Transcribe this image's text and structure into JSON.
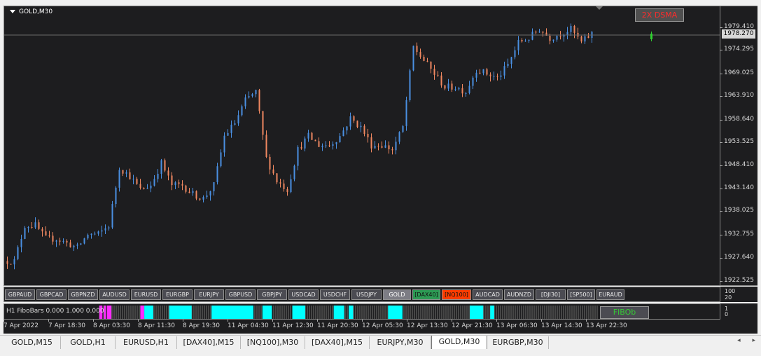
{
  "chart": {
    "symbol_title": "GOLD,M30",
    "indicator_label": "2X DSMA",
    "current_price": "1978.270",
    "price_ticks": [
      "1979.410",
      "1974.295",
      "1969.025",
      "1963.910",
      "1958.640",
      "1953.525",
      "1948.410",
      "1943.140",
      "1938.025",
      "1932.755",
      "1927.640",
      "1922.525"
    ],
    "time_labels": [
      "7 Apr 2022",
      "7 Apr 18:30",
      "8 Apr 03:30",
      "8 Apr 11:30",
      "8 Apr 19:30",
      "11 Apr 04:30",
      "11 Apr 12:30",
      "11 Apr 20:30",
      "12 Apr 05:30",
      "12 Apr 13:30",
      "12 Apr 21:30",
      "13 Apr 06:30",
      "13 Apr 14:30",
      "13 Apr 22:30"
    ],
    "bull_color": "#4a90e2",
    "bear_color": "#f08860"
  },
  "chart_data": {
    "type": "candlestick",
    "ylim": [
      1922.525,
      1979.41
    ],
    "anchors": [
      1927,
      1927,
      1935,
      1935,
      1932,
      1932,
      1931,
      1930,
      1933,
      1933,
      1935,
      1948,
      1946,
      1943,
      1944,
      1949,
      1944,
      1944,
      1942,
      1941,
      1944,
      1955,
      1958,
      1963,
      1965,
      1950,
      1945,
      1943,
      1952,
      1955,
      1953,
      1953,
      1955,
      1959,
      1957,
      1953,
      1953,
      1952,
      1957,
      1975,
      1972,
      1969,
      1966,
      1966,
      1965,
      1970,
      1969,
      1968,
      1971,
      1976,
      1977,
      1979,
      1977,
      1978,
      1979,
      1976,
      1978
    ],
    "candle_count": 168
  },
  "symbol_buttons": [
    {
      "label": "GBPAUD",
      "state": "normal"
    },
    {
      "label": "GBPCAD",
      "state": "normal"
    },
    {
      "label": "GBPNZD",
      "state": "normal"
    },
    {
      "label": "AUDUSD",
      "state": "normal"
    },
    {
      "label": "EURUSD",
      "state": "normal"
    },
    {
      "label": "EURGBP",
      "state": "normal"
    },
    {
      "label": "EURJPY",
      "state": "normal"
    },
    {
      "label": "GBPUSD",
      "state": "normal"
    },
    {
      "label": "GBPJPY",
      "state": "normal"
    },
    {
      "label": "USDCAD",
      "state": "normal"
    },
    {
      "label": "USDCHF",
      "state": "normal"
    },
    {
      "label": "USDJPY",
      "state": "normal"
    },
    {
      "label": "GOLD",
      "state": "selected"
    },
    {
      "label": "[DAX40]",
      "state": "green"
    },
    {
      "label": "[NQ100]",
      "state": "red"
    },
    {
      "label": "AUDCAD",
      "state": "normal"
    },
    {
      "label": "AUDNZD",
      "state": "normal"
    },
    {
      "label": "[DJI30]",
      "state": "normal"
    },
    {
      "label": "[SP500]",
      "state": "normal"
    },
    {
      "label": "EURAUD",
      "state": "normal"
    }
  ],
  "button_axis": {
    "top": "100",
    "bottom": "20"
  },
  "fibo": {
    "label": "H1 FiboBars 0.000 1.000 0.000",
    "button": "FIBOb",
    "axis_top": "1",
    "axis_bottom": "0",
    "segments": [
      {
        "from": 0.0,
        "to": 0.006,
        "color": "#ff2bff"
      },
      {
        "from": 0.009,
        "to": 0.013,
        "color": "#ff2bff"
      },
      {
        "from": 0.015,
        "to": 0.024,
        "color": "#ff2bff"
      },
      {
        "from": 0.082,
        "to": 0.09,
        "color": "#ff2bff"
      },
      {
        "from": 0.09,
        "to": 0.108,
        "color": "#00ffff"
      },
      {
        "from": 0.14,
        "to": 0.185,
        "color": "#00ffff"
      },
      {
        "from": 0.225,
        "to": 0.309,
        "color": "#00ffff"
      },
      {
        "from": 0.327,
        "to": 0.346,
        "color": "#00ffff"
      },
      {
        "from": 0.387,
        "to": 0.413,
        "color": "#00ffff"
      },
      {
        "from": 0.47,
        "to": 0.491,
        "color": "#00ffff"
      },
      {
        "from": 0.5,
        "to": 0.509,
        "color": "#00ffff"
      },
      {
        "from": 0.579,
        "to": 0.608,
        "color": "#00ffff"
      },
      {
        "from": 0.743,
        "to": 0.77,
        "color": "#00ffff"
      },
      {
        "from": 0.784,
        "to": 0.792,
        "color": "#00ffff"
      }
    ]
  },
  "tabs": [
    {
      "label": "GOLD,M15",
      "active": false
    },
    {
      "label": "GOLD,H1",
      "active": false
    },
    {
      "label": "EURUSD,H1",
      "active": false
    },
    {
      "label": "[DAX40],M15",
      "active": false
    },
    {
      "label": "[NQ100],M30",
      "active": false
    },
    {
      "label": "[DAX40],M15",
      "active": false
    },
    {
      "label": "EURJPY,M30",
      "active": false
    },
    {
      "label": "GOLD,M30",
      "active": true
    },
    {
      "label": "EURGBP,M30",
      "active": false
    }
  ],
  "tab_nav": {
    "prev": "◂",
    "next": "▸"
  }
}
